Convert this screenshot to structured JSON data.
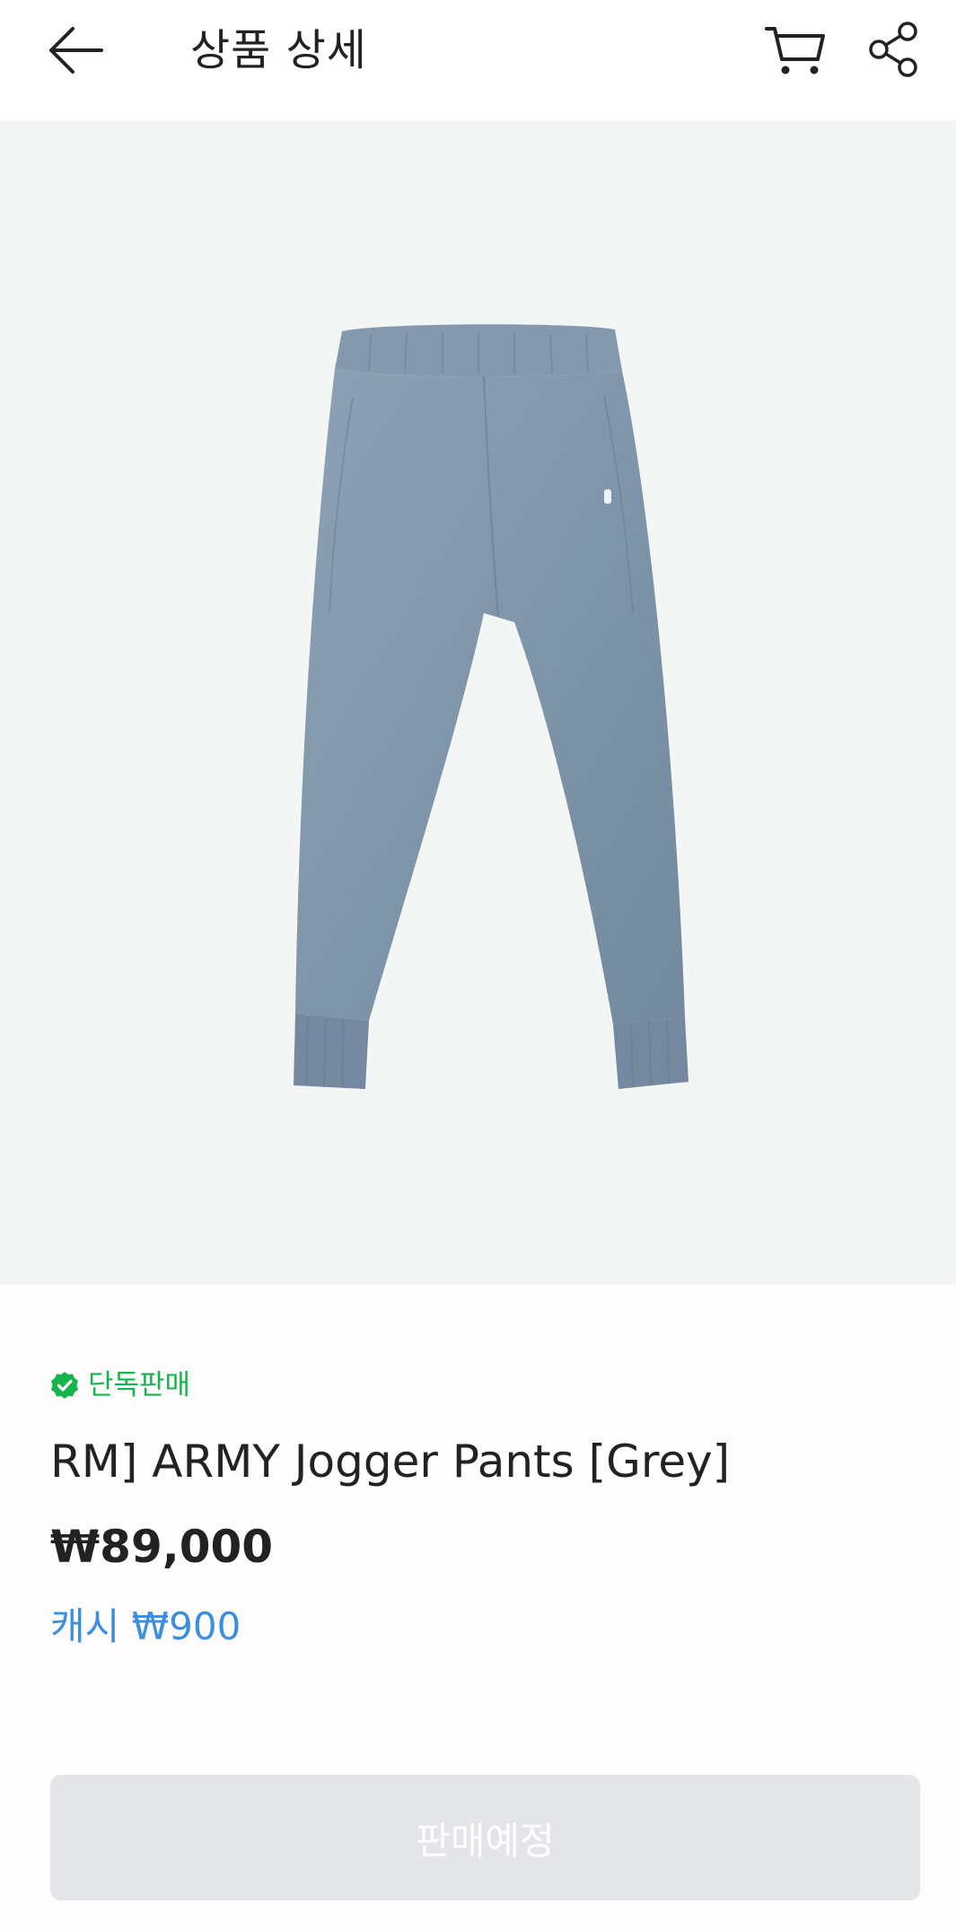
{
  "header": {
    "title": "상품 상세",
    "back_icon": "arrow-left-icon",
    "cart_icon": "cart-icon",
    "share_icon": "share-icon"
  },
  "product": {
    "image_icon": "jogger-pants-image",
    "badge_label": "단독판매",
    "badge_icon": "verified-check-icon",
    "name": "RM] ARMY Jogger Pants [Grey]",
    "price": "₩89,000",
    "cash": "캐시 ₩900"
  },
  "cta": {
    "label": "판매예정"
  },
  "colors": {
    "accent_green": "#17b34d",
    "cash_blue": "#3b8fde",
    "button_disabled": "#e3e5e8",
    "image_bg": "#f4f5f5"
  }
}
